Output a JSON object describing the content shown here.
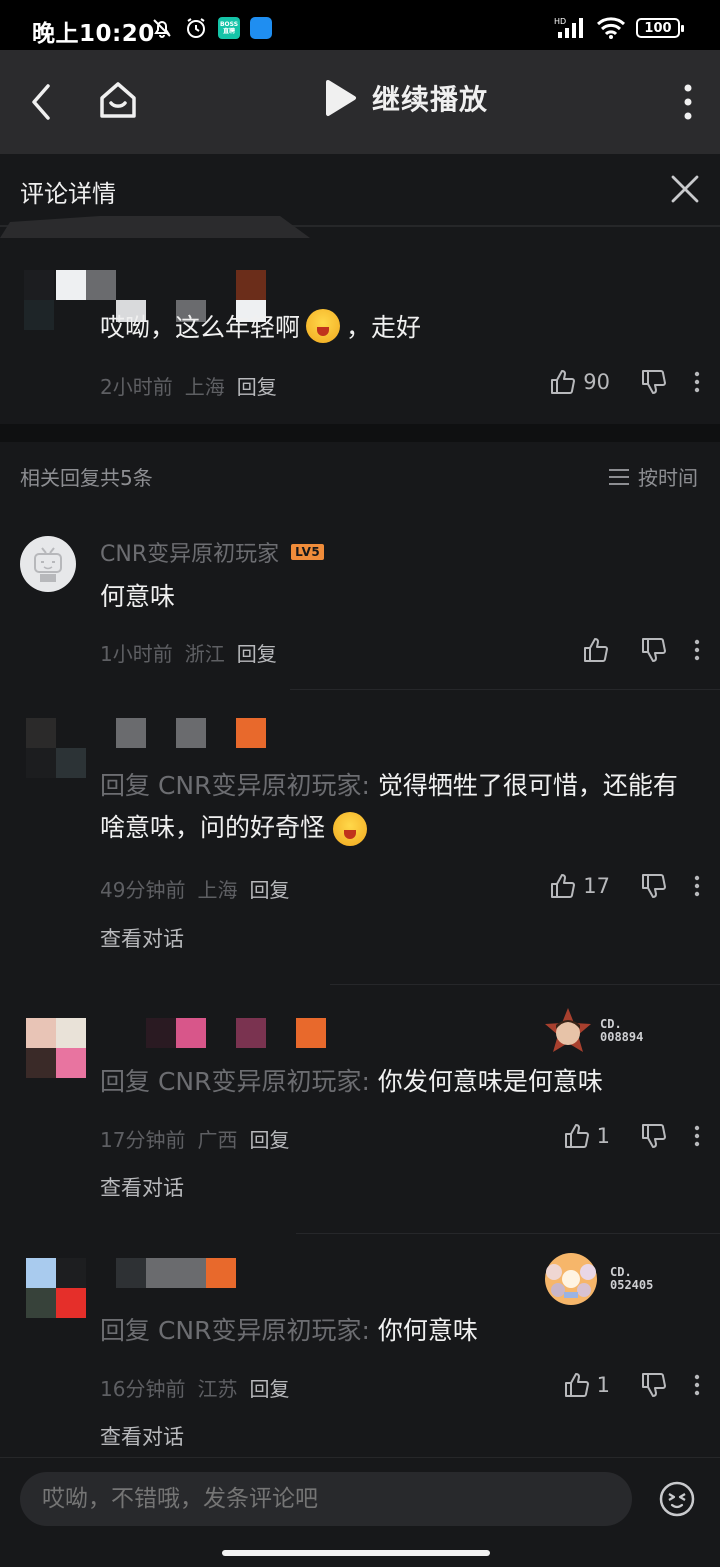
{
  "status_bar": {
    "time": "晚上10:20",
    "battery": "100",
    "signal_label": "HD",
    "boss_badge_top": "BOSS",
    "boss_badge_bottom": "直聘"
  },
  "top_bar": {
    "play_label": "继续播放"
  },
  "panel": {
    "title": "评论详情"
  },
  "main_comment": {
    "text_before": "哎呦，这么年轻啊",
    "text_after": "，走好",
    "time": "2小时前",
    "location": "上海",
    "reply_label": "回复",
    "likes": "90"
  },
  "replies_header": {
    "count": "相关回复共5条",
    "sort": "按时间"
  },
  "replies": [
    {
      "username": "CNR变异原初玩家",
      "level": "LV5",
      "text": "何意味",
      "time": "1小时前",
      "location": "浙江",
      "reply_label": "回复",
      "likes": ""
    },
    {
      "prefix": "回复 CNR变异原初玩家:",
      "text": " 觉得牺牲了很可惜，还能有啥意味，问的好奇怪",
      "time": "49分钟前",
      "location": "上海",
      "reply_label": "回复",
      "likes": "17",
      "view_conversation": "查看对话"
    },
    {
      "prefix": "回复 CNR变异原初玩家:",
      "text": " 你发何意味是何意味",
      "time": "17分钟前",
      "location": "广西",
      "reply_label": "回复",
      "likes": "1",
      "view_conversation": "查看对话",
      "badge_line1": "CD.",
      "badge_line2": "008894"
    },
    {
      "prefix": "回复 CNR变异原初玩家:",
      "text": " 你何意味",
      "time": "16分钟前",
      "location": "江苏",
      "reply_label": "回复",
      "likes": "1",
      "view_conversation": "查看对话",
      "badge_line1": "CD.",
      "badge_line2": "052405"
    }
  ],
  "bottom_bar": {
    "placeholder": "哎呦，不错哦，发条评论吧"
  },
  "colors": {
    "background": "#17181a",
    "top_bar": "#2b2b2d",
    "level_badge": "#f08c3a",
    "muted_text": "#6c6d71"
  }
}
